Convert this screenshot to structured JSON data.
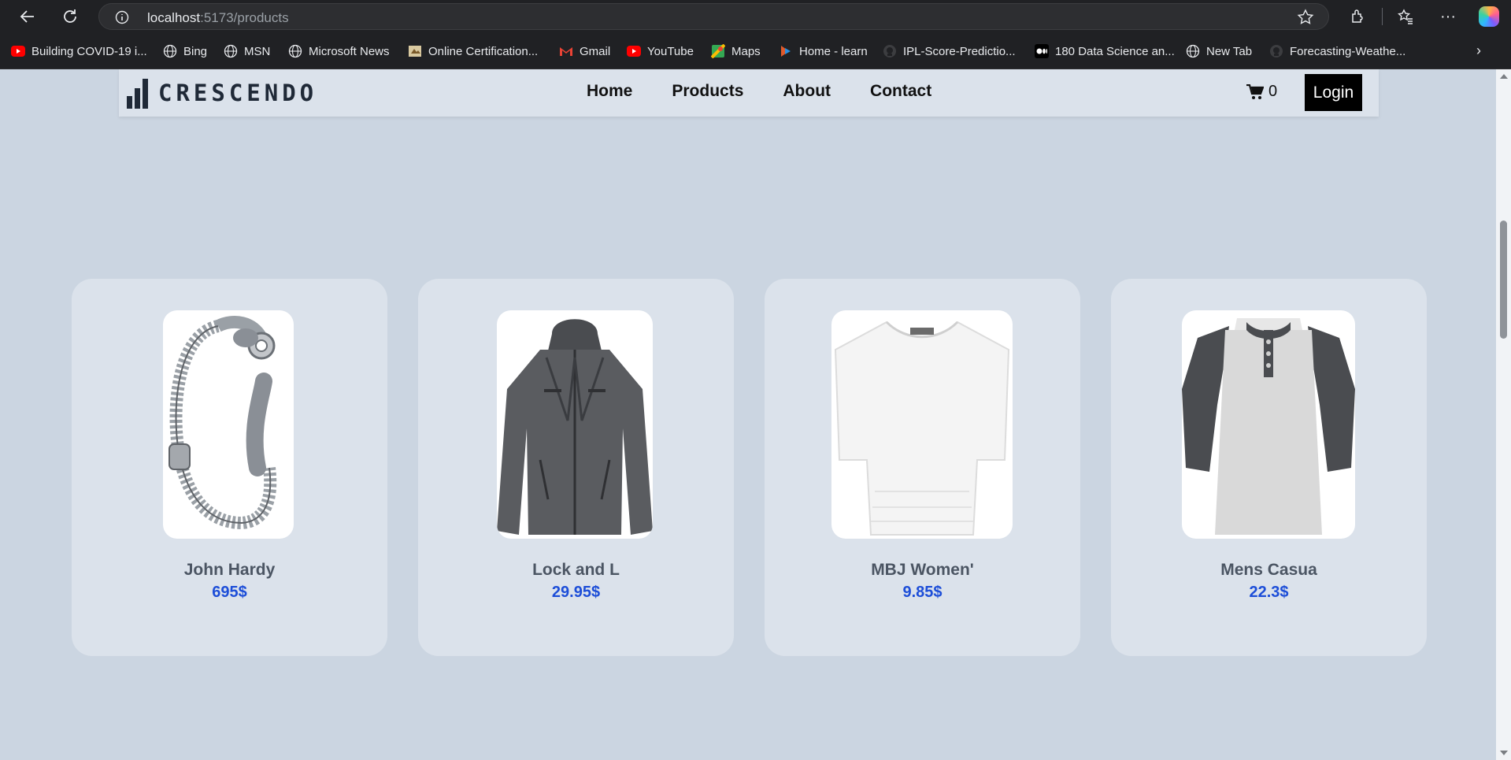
{
  "browser": {
    "url_host": "localhost",
    "url_path": ":5173/products",
    "bookmarks": [
      {
        "label": "Building COVID-19 i...",
        "icon": "youtube-icon",
        "color": "#ff0000"
      },
      {
        "label": "Bing",
        "icon": "globe-icon"
      },
      {
        "label": "MSN",
        "icon": "globe-icon"
      },
      {
        "label": "Microsoft News",
        "icon": "globe-icon"
      },
      {
        "label": "Online Certification...",
        "icon": "certificate-icon"
      },
      {
        "label": "Gmail",
        "icon": "gmail-icon"
      },
      {
        "label": "YouTube",
        "icon": "youtube-icon",
        "color": "#ff0000"
      },
      {
        "label": "Maps",
        "icon": "maps-icon"
      },
      {
        "label": "Home - learn",
        "icon": "learn-icon"
      },
      {
        "label": "IPL-Score-Predictio...",
        "icon": "github-icon"
      },
      {
        "label": "180 Data Science an...",
        "icon": "medium-icon"
      },
      {
        "label": "New Tab",
        "icon": "globe-icon"
      },
      {
        "label": "Forecasting-Weathe...",
        "icon": "github-icon"
      }
    ]
  },
  "site": {
    "logo": "CRESCENDO",
    "nav": [
      "Home",
      "Products",
      "About",
      "Contact"
    ],
    "cart_count": "0",
    "login_label": "Login"
  },
  "products": [
    {
      "name": "John Hardy",
      "price": "695$",
      "image": "silver-bracelet"
    },
    {
      "name": "Lock and L",
      "price": "29.95$",
      "image": "gray-jacket"
    },
    {
      "name": "MBJ Women'",
      "price": "9.85$",
      "image": "white-tshirt"
    },
    {
      "name": "Mens Casua",
      "price": "22.3$",
      "image": "raglan-henley"
    }
  ]
}
